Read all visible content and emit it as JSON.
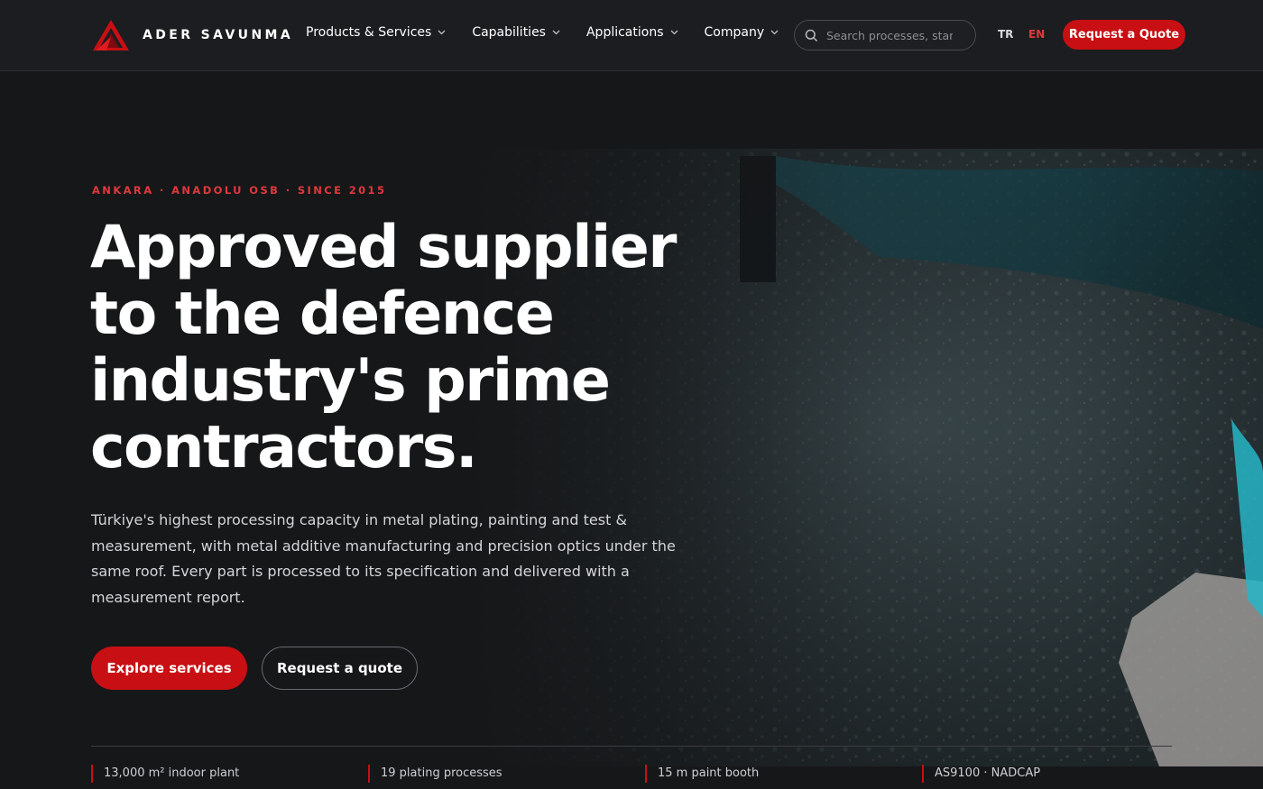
{
  "brand": {
    "name": "ADER SAVUNMA"
  },
  "nav": {
    "items": [
      {
        "label": "Products & Services"
      },
      {
        "label": "Capabilities"
      },
      {
        "label": "Applications"
      },
      {
        "label": "Company"
      }
    ]
  },
  "search": {
    "placeholder": "Search processes, standards"
  },
  "languages": {
    "tr": "TR",
    "en": "EN",
    "active": "EN"
  },
  "header_cta": {
    "label": "Request a Quote"
  },
  "hero": {
    "eyebrow": "ANKARA · ANADOLU OSB · SINCE 2015",
    "headline": "Approved supplier to the defence industry's prime contractors.",
    "lead": "Türkiye's highest processing capacity in metal plating, painting and test & measurement, with metal additive manufacturing and precision optics under the same roof. Every part is processed to its specification and delivered with a measurement report.",
    "primary_button": "Explore services",
    "secondary_button": "Request a quote"
  },
  "stats": [
    {
      "label": "13,000 m² indoor plant"
    },
    {
      "label": "19 plating processes"
    },
    {
      "label": "15 m paint booth"
    },
    {
      "label": "AS9100 · NADCAP"
    }
  ],
  "colors": {
    "accent": "#c80f14",
    "accent_text": "#e0383c",
    "background": "#161719",
    "header": "#1c1d20"
  },
  "icons": {
    "logo": "triangle-logo-icon",
    "chevron": "chevron-down-icon",
    "search": "search-icon"
  }
}
